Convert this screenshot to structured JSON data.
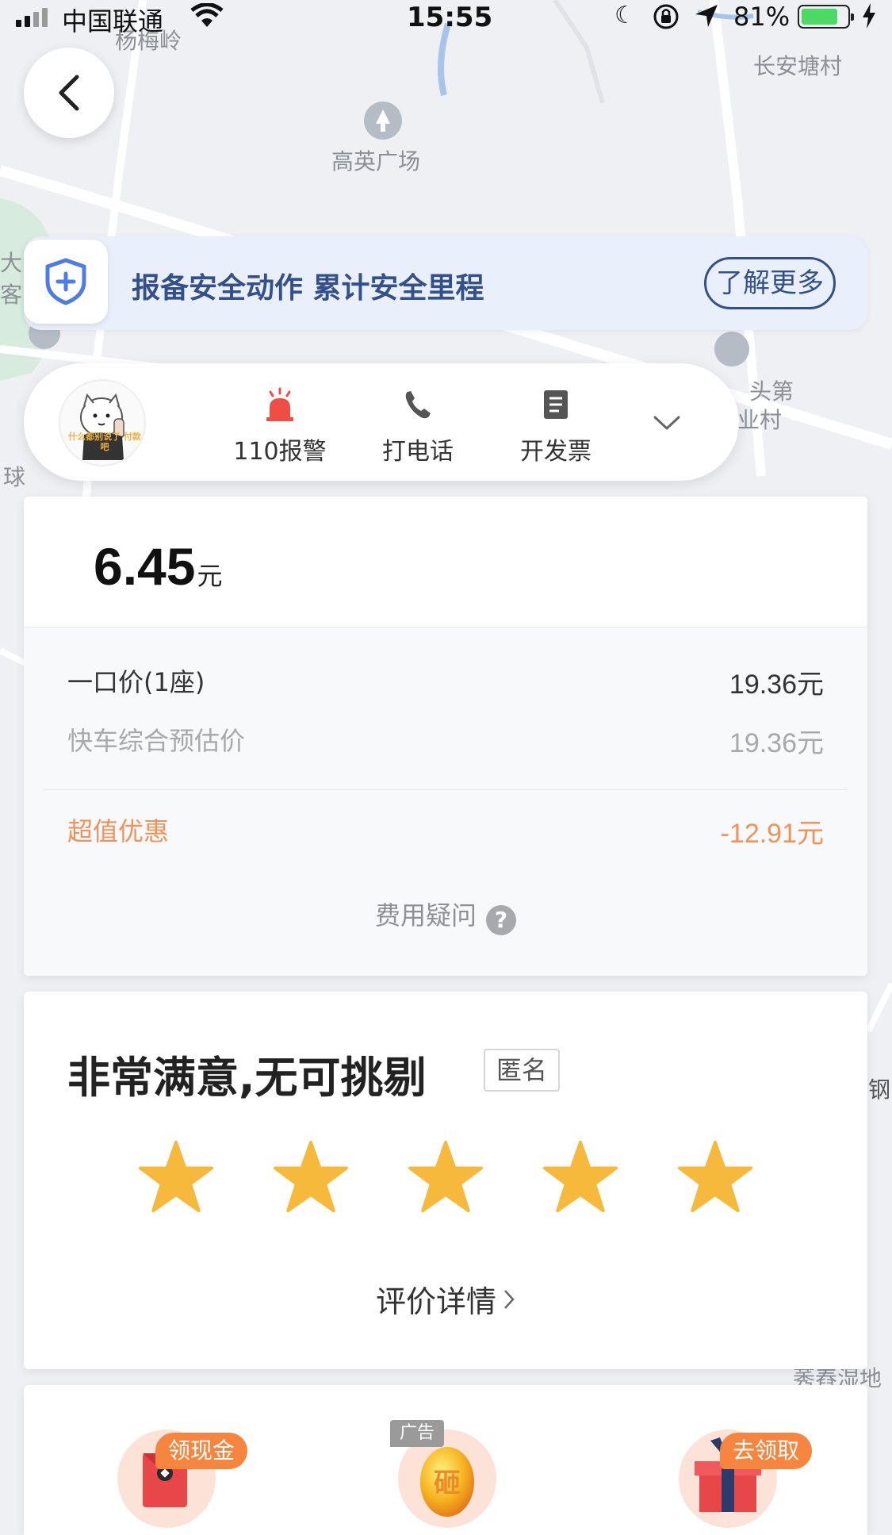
{
  "status_bar": {
    "carrier": "中国联通",
    "time": "15:55",
    "battery": "81%",
    "battery_level": 0.81
  },
  "map_labels": {
    "yangmeiling": "杨梅岭",
    "changantang": "长安塘村",
    "gaoying": "高英广场",
    "toudi_line1": "头第",
    "toudi_line2": "业村",
    "left_edge_1": "大自",
    "left_edge_2": "客",
    "left_edge_3": "球",
    "right_edge": "钢",
    "bottom_right": "莠舂湿地"
  },
  "safety_banner": {
    "text": "报备安全动作 累计安全里程",
    "button": "了解更多"
  },
  "avatar": {
    "caption": "什么都别说了 付款吧"
  },
  "actions": {
    "police": "110报警",
    "call": "打电话",
    "invoice": "开发票"
  },
  "fare": {
    "amount": "6.45",
    "unit": "元",
    "fixed_price_label": "一口价(1座)",
    "fixed_price_value": "19.36元",
    "estimate_label": "快车综合预估价",
    "estimate_value": "19.36元",
    "discount_label": "超值优惠",
    "discount_value": "-12.91元",
    "question": "费用疑问"
  },
  "rating": {
    "title": "非常满意,无可挑剔",
    "anonymous": "匿名",
    "stars": 5,
    "detail_link": "评价详情"
  },
  "promos": {
    "cash_badge": "领现金",
    "ad_tag": "广告",
    "egg_label": "砸",
    "gift_badge": "去领取"
  },
  "colors": {
    "brand_blue": "#34508a",
    "discount_orange": "#f0925a",
    "star_yellow": "#f6b93b",
    "promo_orange": "#f6863f"
  }
}
